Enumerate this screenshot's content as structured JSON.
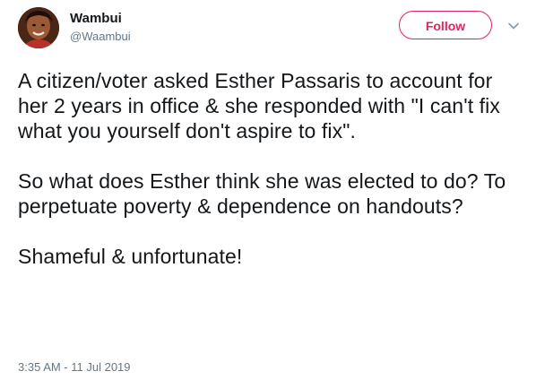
{
  "author": {
    "display_name": "Wambui",
    "handle": "@Waambui"
  },
  "actions": {
    "follow_label": "Follow",
    "menu_icon": "chevron-down-icon"
  },
  "tweet": {
    "paragraph_1": "A citizen/voter asked Esther Passaris to account for her 2 years in office & she responded with \"I can't fix what you yourself don't aspire to fix\".",
    "paragraph_2": "So what does Esther think she was elected to do? To perpetuate poverty & dependence on handouts?",
    "paragraph_3": "Shameful & unfortunate!",
    "timestamp": "3:35 AM - 11 Jul 2019"
  },
  "colors": {
    "follow_accent": "#e0245e",
    "text": "#14171a",
    "secondary_text": "#657786"
  }
}
